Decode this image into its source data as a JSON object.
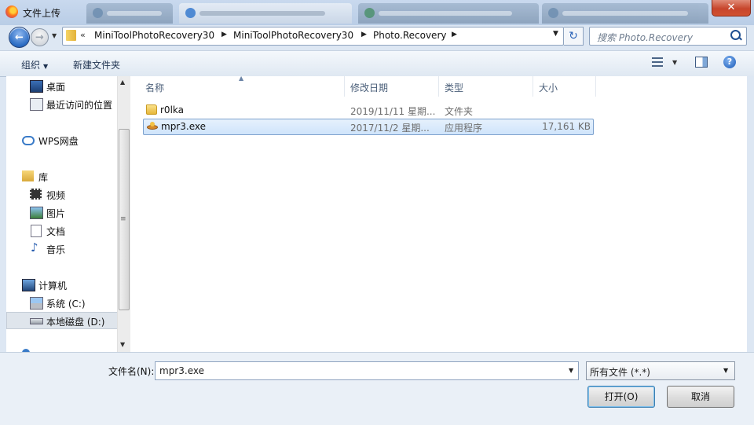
{
  "window": {
    "title": "文件上传",
    "close_glyph": "✕",
    "background_tab_count": 4
  },
  "address": {
    "overflow": "«",
    "crumbs": [
      "MiniToolPhotoRecovery30",
      "MiniToolPhotoRecovery30",
      "Photo.Recovery"
    ],
    "refresh_glyph": "↻"
  },
  "search": {
    "placeholder": "搜索 Photo.Recovery"
  },
  "toolbar": {
    "organize": "组织",
    "new_folder": "新建文件夹",
    "help": "?"
  },
  "nav": {
    "items": [
      {
        "label": "桌面",
        "icon": "desktop-icon"
      },
      {
        "label": "最近访问的位置",
        "icon": "recent-places-icon"
      },
      {
        "label": "WPS网盘",
        "icon": "cloud-icon"
      },
      {
        "label": "库",
        "icon": "library-icon"
      },
      {
        "label": "视频",
        "icon": "video-icon"
      },
      {
        "label": "图片",
        "icon": "picture-icon"
      },
      {
        "label": "文档",
        "icon": "document-icon"
      },
      {
        "label": "音乐",
        "icon": "music-icon"
      },
      {
        "label": "计算机",
        "icon": "computer-icon"
      },
      {
        "label": "系统 (C:)",
        "icon": "system-drive-icon"
      },
      {
        "label": "本地磁盘 (D:)",
        "icon": "local-drive-icon",
        "selected": true
      }
    ]
  },
  "columns": {
    "name": "名称",
    "date": "修改日期",
    "type": "类型",
    "size": "大小"
  },
  "files": [
    {
      "name": "r0lka",
      "date": "2019/11/11 星期...",
      "type": "文件夹",
      "size": "",
      "icon": "folder-icon"
    },
    {
      "name": "mpr3.exe",
      "date": "2017/11/2 星期...",
      "type": "应用程序",
      "size": "17,161 KB",
      "icon": "exe-icon",
      "selected": true
    }
  ],
  "footer": {
    "filename_label": "文件名(N):",
    "filename_value": "mpr3.exe",
    "filetype_value": "所有文件 (*.*)",
    "open_button": "打开(O)",
    "cancel_button": "取消"
  },
  "colors": {
    "accent": "#2a6bc3",
    "selection": "#cfe4fb",
    "close": "#c7452c"
  }
}
